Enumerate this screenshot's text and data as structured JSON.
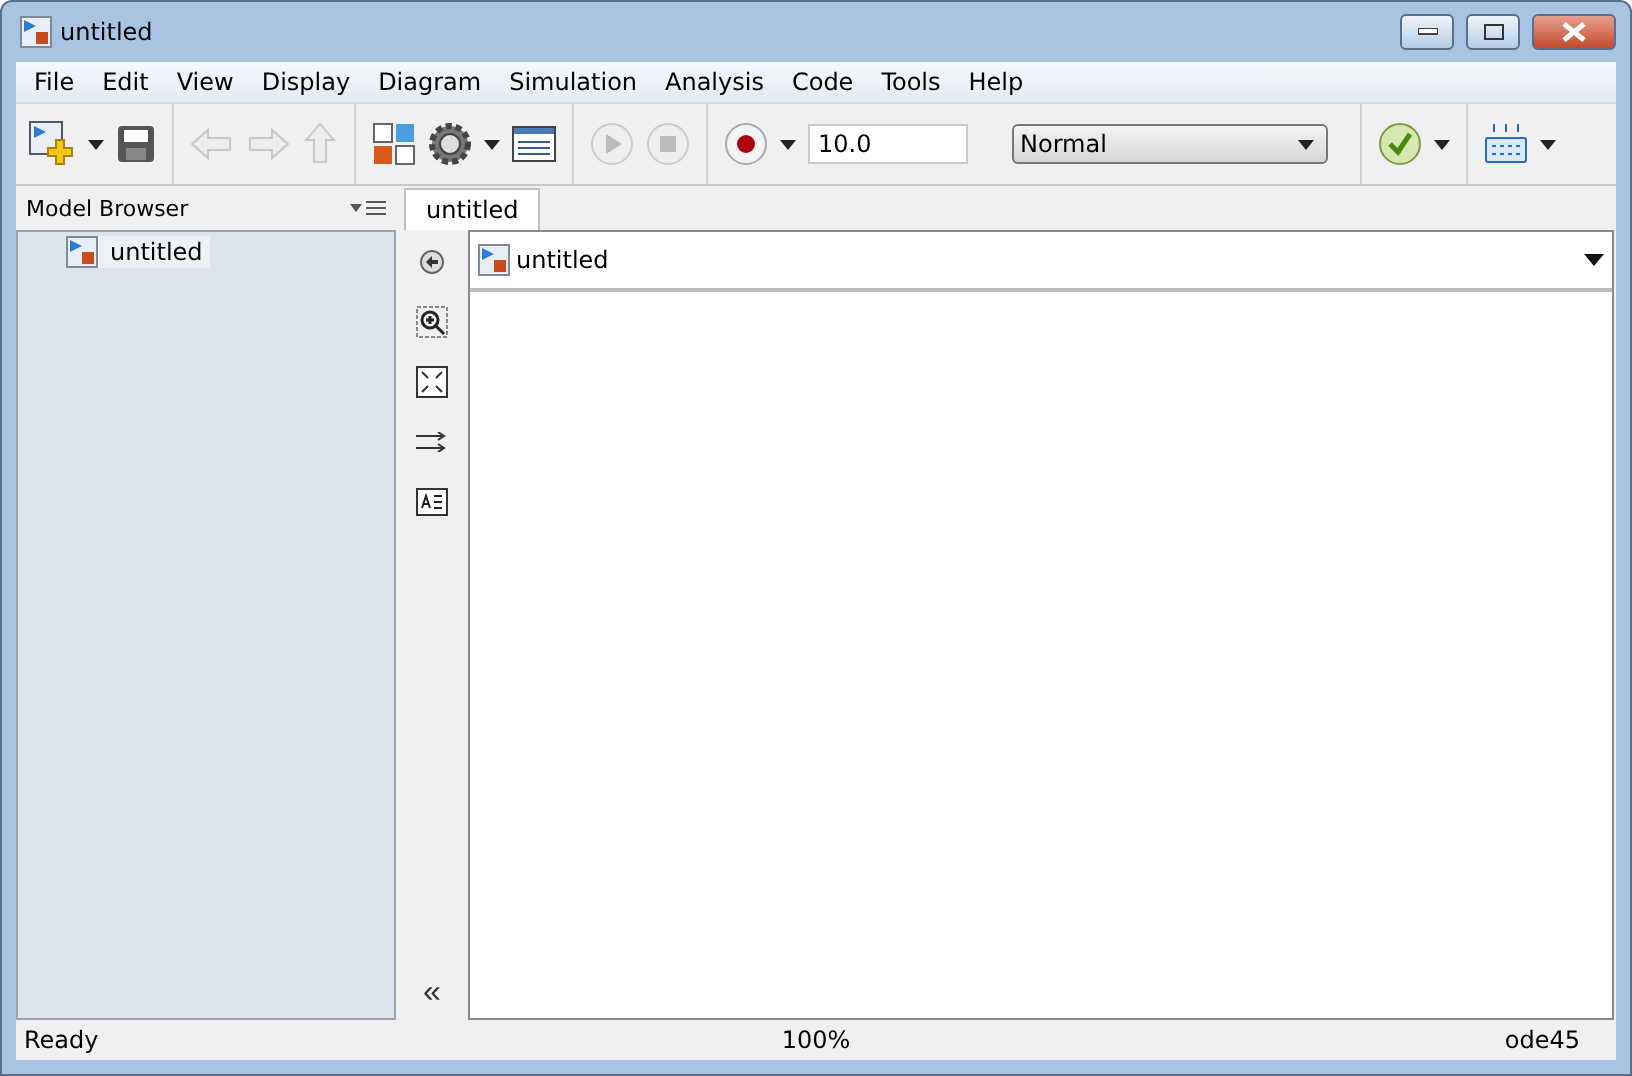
{
  "window": {
    "title": "untitled"
  },
  "menu": [
    "File",
    "Edit",
    "View",
    "Display",
    "Diagram",
    "Simulation",
    "Analysis",
    "Code",
    "Tools",
    "Help"
  ],
  "toolbar": {
    "stop_time": "10.0",
    "mode": "Normal"
  },
  "model_browser": {
    "title": "Model Browser",
    "items": [
      {
        "label": "untitled",
        "selected": true
      }
    ]
  },
  "tabs": [
    {
      "label": "untitled",
      "selected": true
    }
  ],
  "address": "untitled",
  "palette_collapse": "«",
  "status_bar": {
    "left": "Ready",
    "center": "100%",
    "right": "ode45"
  }
}
